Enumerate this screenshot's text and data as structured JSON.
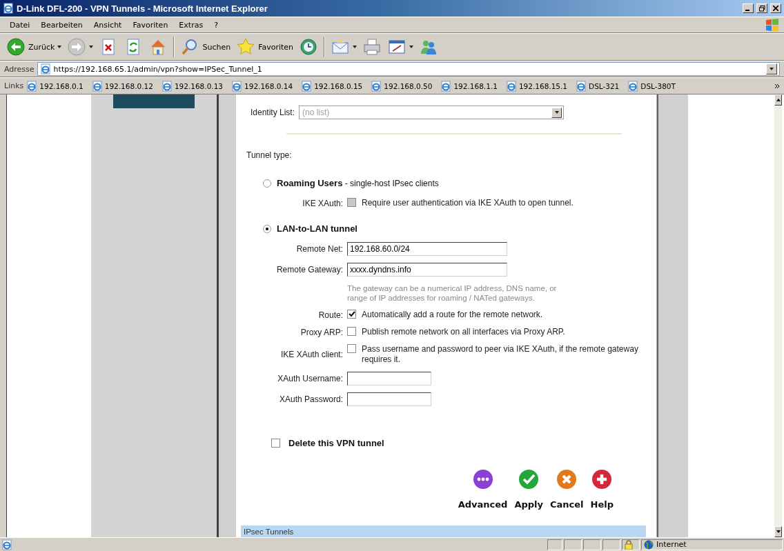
{
  "window": {
    "title": "D-Link DFL-200 - VPN Tunnels - Microsoft Internet Explorer"
  },
  "menu": [
    "Datei",
    "Bearbeiten",
    "Ansicht",
    "Favoriten",
    "Extras",
    "?"
  ],
  "toolbar": [
    {
      "kind": "back",
      "label": "Zurück",
      "dropdown": true
    },
    {
      "kind": "forward",
      "dropdown": true
    },
    {
      "kind": "stop",
      "dropdown": false
    },
    {
      "kind": "refresh",
      "dropdown": false
    },
    {
      "kind": "home",
      "dropdown": false
    },
    {
      "kind": "separator"
    },
    {
      "kind": "search",
      "label": "Suchen",
      "dropdown": false
    },
    {
      "kind": "favorites",
      "label": "Favoriten",
      "dropdown": false
    },
    {
      "kind": "history",
      "dropdown": false
    },
    {
      "kind": "separator"
    },
    {
      "kind": "mail",
      "dropdown": true
    },
    {
      "kind": "print",
      "dropdown": false
    },
    {
      "kind": "edit",
      "dropdown": true
    },
    {
      "kind": "messenger",
      "dropdown": false
    }
  ],
  "address": {
    "label": "Adresse",
    "url": "https://192.168.65.1/admin/vpn?show=IPSec_Tunnel_1"
  },
  "links": {
    "label": "Links",
    "items": [
      "192.168.0.1",
      "192.168.0.12",
      "192.168.0.13",
      "192.168.0.14",
      "192.168.0.15",
      "192.168.0.50",
      "192.168.1.1",
      "192.168.15.1",
      "DSL-321",
      "DSL-380T"
    ]
  },
  "form": {
    "identity": {
      "label": "Identity List:",
      "value": "(no list)",
      "disabled": true
    },
    "tunnel_type": {
      "label": "Tunnel type:",
      "options": [
        {
          "label": "**Roaming Users** - single-host IPsec clients",
          "selected": false,
          "fields": [
            {
              "kind": "checkbox",
              "label": "IKE XAuth:",
              "text": "Require user authentication via IKE XAuth to open tunnel.",
              "checked": false,
              "disabled": true
            }
          ]
        },
        {
          "label": "LAN-to-LAN tunnel",
          "selected": true,
          "fields": [
            {
              "kind": "input",
              "label": "Remote Net:",
              "value": "192.168.60.0/24"
            },
            {
              "kind": "input",
              "label": "Remote Gateway:",
              "value": "xxxx.dyndns.info"
            },
            {
              "kind": "hint",
              "text": "The gateway can be a numerical IP address, DNS name, or range of IP addresses for roaming / NATed gateways."
            },
            {
              "kind": "checkbox",
              "label": "Route:",
              "text": "Automatically add a route for the remote network.",
              "checked": true,
              "disabled": false
            },
            {
              "kind": "checkbox",
              "label": "Proxy ARP:",
              "text": "Publish remote network on all interfaces via Proxy ARP.",
              "checked": false,
              "disabled": false
            },
            {
              "kind": "checkbox",
              "label": "IKE XAuth client:",
              "text": "Pass username and password to peer via IKE XAuth, if the remote gateway requires it.",
              "checked": false,
              "disabled": false
            },
            {
              "kind": "short_input",
              "label": "XAuth Username:"
            },
            {
              "kind": "short_input",
              "label": "XAuth Password:"
            }
          ]
        }
      ]
    },
    "delete": {
      "label": "Delete this VPN tunnel",
      "checked": false
    },
    "actions": [
      {
        "kind": "advanced",
        "label": "Advanced"
      },
      {
        "kind": "apply",
        "label": "Apply"
      },
      {
        "kind": "cancel",
        "label": "Cancel"
      },
      {
        "kind": "help",
        "label": "Help"
      }
    ],
    "section_bar": "IPsec Tunnels"
  },
  "status_bar": {
    "zone": "Internet"
  }
}
